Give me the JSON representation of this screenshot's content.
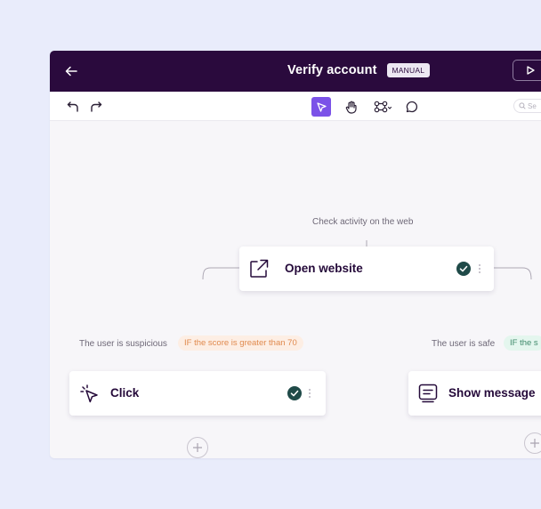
{
  "header": {
    "back_icon": "arrow-left-icon",
    "title": "Verify account",
    "badge": "MANUAL",
    "run_icon": "play-icon"
  },
  "toolbar": {
    "undo_icon": "undo-icon",
    "redo_icon": "redo-icon",
    "tools": [
      {
        "name": "select-cursor-icon",
        "active": true
      },
      {
        "name": "hand-icon",
        "active": false
      },
      {
        "name": "nodes-icon",
        "active": false
      },
      {
        "name": "comment-icon",
        "active": false
      }
    ],
    "search_placeholder": "Se"
  },
  "flow": {
    "root_caption": "Check activity on the web",
    "root_node": {
      "label": "Open website",
      "icon": "external-link-icon",
      "status": "done"
    },
    "branches": [
      {
        "caption": "The user is suspicious",
        "condition": "IF the score is greater than 70",
        "condition_color": "#e08a4e",
        "node": {
          "label": "Click",
          "icon": "cursor-click-icon",
          "status": "done"
        }
      },
      {
        "caption": "The user is safe",
        "condition": "IF the s",
        "condition_color": "#3f8a6b",
        "node": {
          "label": "Show message",
          "icon": "message-icon",
          "status": ""
        }
      }
    ]
  },
  "colors": {
    "header_bg": "#2a0a3d",
    "accent": "#7b52e8",
    "check": "#1f4a48"
  }
}
